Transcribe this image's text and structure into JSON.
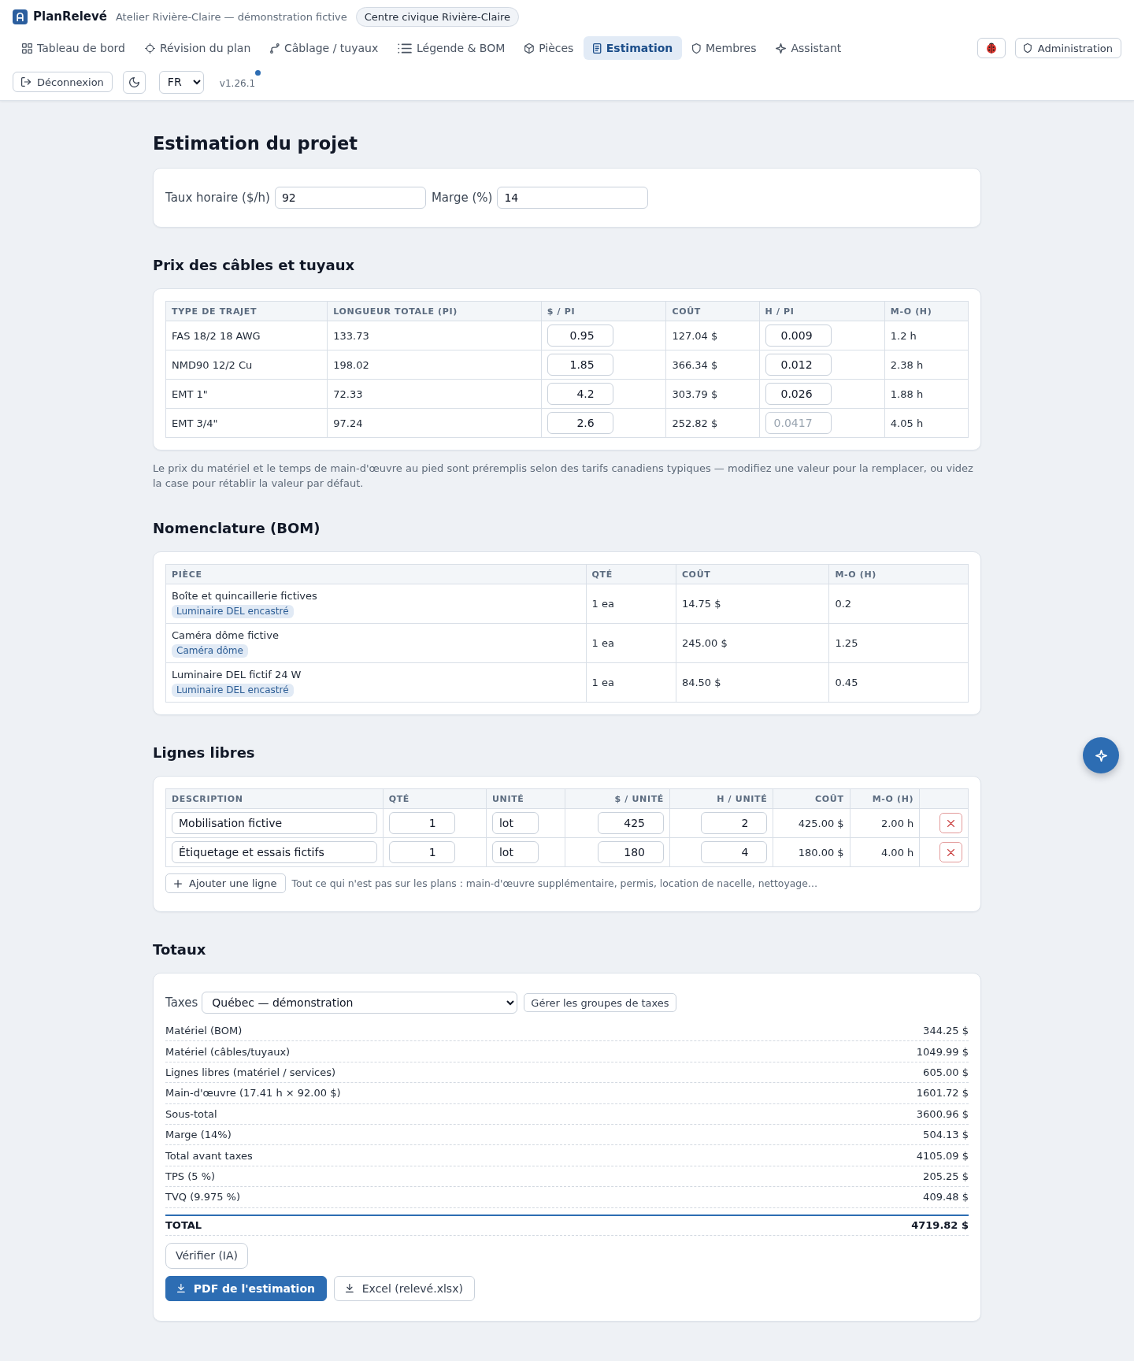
{
  "app": {
    "name": "PlanRelevé",
    "workspace": "Atelier Rivière-Claire — démonstration fictive",
    "project": "Centre civique Rivière-Claire"
  },
  "nav": [
    {
      "label": "Tableau de bord",
      "selected": false
    },
    {
      "label": "Révision du plan",
      "selected": false
    },
    {
      "label": "Câblage / tuyaux",
      "selected": false
    },
    {
      "label": "Légende & BOM",
      "selected": false
    },
    {
      "label": "Pièces",
      "selected": false
    },
    {
      "label": "Estimation",
      "selected": true
    },
    {
      "label": "Membres",
      "selected": false
    },
    {
      "label": "Assistant",
      "selected": false
    }
  ],
  "header_actions": {
    "admin": "Administration"
  },
  "toolbar": {
    "logout": "Déconnexion",
    "language": "FR",
    "version": "v1.26.1",
    "update_available": true
  },
  "page": {
    "title": "Estimation du projet"
  },
  "rates": [
    {
      "label": "Taux horaire ($/h)",
      "value": "92"
    },
    {
      "label": "Marge (%)",
      "value": "14"
    }
  ],
  "cables": {
    "heading": "Prix des câbles et tuyaux",
    "columns": [
      "TYPE DE TRAJET",
      "LONGUEUR TOTALE (PI)",
      "$ / PI",
      "COÛT",
      "H / PI",
      "M-O (H)"
    ],
    "rows": [
      {
        "route": "FAS 18/2 18 AWG",
        "length": "133.73",
        "price": {
          "value": "0.95"
        },
        "cost": "127.04 $",
        "hours": {
          "value": "0.009"
        },
        "labor": "1.2 h"
      },
      {
        "route": "NMD90 12/2 Cu",
        "length": "198.02",
        "price": {
          "value": "1.85"
        },
        "cost": "366.34 $",
        "hours": {
          "value": "0.012"
        },
        "labor": "2.38 h"
      },
      {
        "route": "EMT 1\"",
        "length": "72.33",
        "price": {
          "value": "4.2"
        },
        "cost": "303.79 $",
        "hours": {
          "value": "0.026"
        },
        "labor": "1.88 h"
      },
      {
        "route": "EMT 3/4\"",
        "length": "97.24",
        "price": {
          "value": "2.6"
        },
        "cost": "252.82 $",
        "hours": {
          "placeholder": "0.0417"
        },
        "labor": "4.05 h"
      }
    ],
    "note": "Le prix du matériel et le temps de main-d'œuvre au pied sont préremplis selon des tarifs canadiens typiques — modifiez une valeur pour la remplacer, ou videz la case pour rétablir la valeur par défaut."
  },
  "bom": {
    "heading": "Nomenclature (BOM)",
    "columns": [
      "PIÈCE",
      "QTÉ",
      "COÛT",
      "M-O (H)"
    ],
    "rows": [
      {
        "part": "Boîte et quincaillerie fictives",
        "tag": "Luminaire DEL encastré",
        "qty": "1 ea",
        "cost": "14.75 $",
        "labor": "0.2"
      },
      {
        "part": "Caméra dôme fictive",
        "tag": "Caméra dôme",
        "qty": "1 ea",
        "cost": "245.00 $",
        "labor": "1.25"
      },
      {
        "part": "Luminaire DEL fictif 24 W",
        "tag": "Luminaire DEL encastré",
        "qty": "1 ea",
        "cost": "84.50 $",
        "labor": "0.45"
      }
    ]
  },
  "custom_lines": {
    "heading": "Lignes libres",
    "columns": [
      "DESCRIPTION",
      "QTÉ",
      "UNITÉ",
      "$ / UNITÉ",
      "H / UNITÉ",
      "COÛT",
      "M-O (H)"
    ],
    "rows": [
      {
        "description": "Mobilisation fictive",
        "qty": "1",
        "unit": "lot",
        "price": "425",
        "hours": "2",
        "cost": "425.00 $",
        "labor": "2.00 h"
      },
      {
        "description": "Étiquetage et essais fictifs",
        "qty": "1",
        "unit": "lot",
        "price": "180",
        "hours": "4",
        "cost": "180.00 $",
        "labor": "4.00 h"
      }
    ],
    "add_button": "Ajouter une ligne",
    "hint": "Tout ce qui n'est pas sur les plans : main-d'œuvre supplémentaire, permis, location de nacelle, nettoyage…"
  },
  "totals": {
    "heading": "Totaux",
    "tax": {
      "label": "Taxes",
      "value": "Québec — démonstration",
      "manage": "Gérer les groupes de taxes"
    },
    "lines": [
      {
        "label": "Matériel (BOM)",
        "amount": "344.25 $"
      },
      {
        "label": "Matériel (câbles/tuyaux)",
        "amount": "1049.99 $"
      },
      {
        "label": "Lignes libres (matériel / services)",
        "amount": "605.00 $"
      },
      {
        "label": "Main-d'œuvre (17.41 h × 92.00 $)",
        "amount": "1601.72 $"
      },
      {
        "label": "Sous-total",
        "amount": "3600.96 $"
      },
      {
        "label": "Marge (14%)",
        "amount": "504.13 $"
      },
      {
        "label": "Total avant taxes",
        "amount": "4105.09 $"
      },
      {
        "label": "TPS (5 %)",
        "amount": "205.25 $"
      },
      {
        "label": "TVQ (9.975 %)",
        "amount": "409.48 $"
      }
    ],
    "total": {
      "label": "TOTAL",
      "amount": "4719.82 $"
    },
    "verify": "Vérifier (IA)",
    "exports": [
      {
        "label": "PDF de l'estimation",
        "kind": "primary"
      },
      {
        "label": "Excel (relevé.xlsx)",
        "kind": "secondary"
      }
    ]
  }
}
